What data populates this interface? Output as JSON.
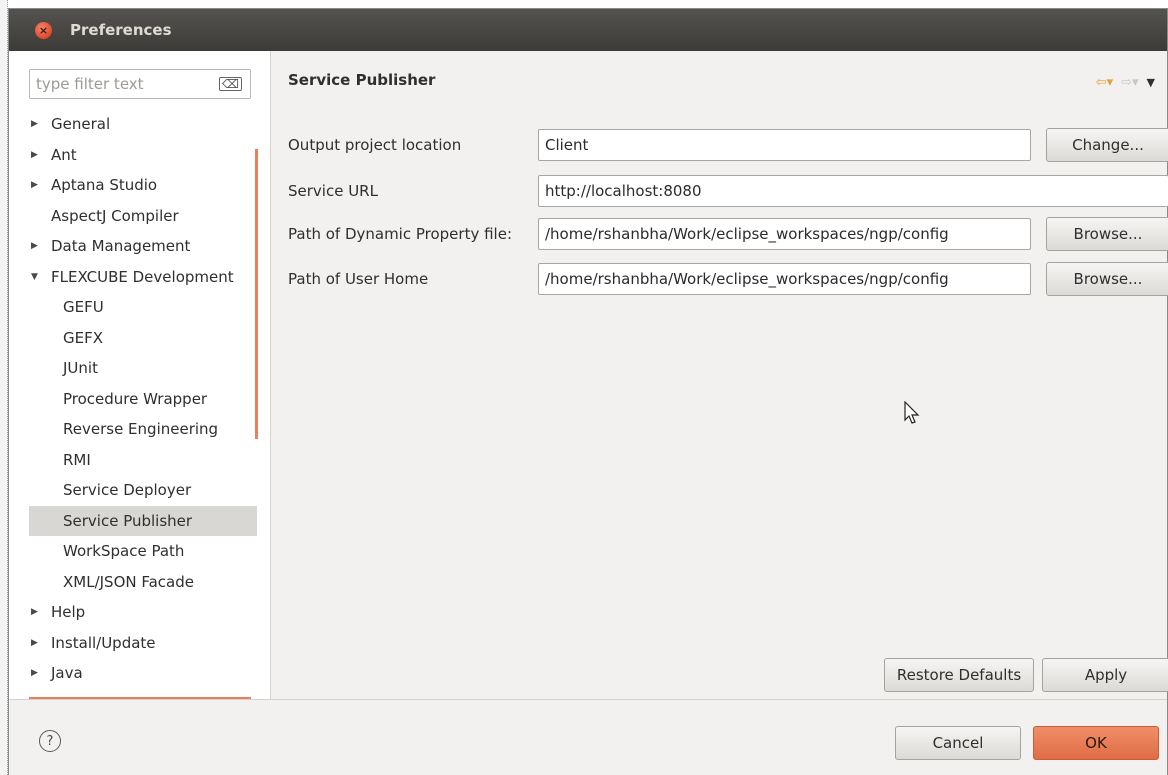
{
  "dialog": {
    "title": "Preferences"
  },
  "filter": {
    "placeholder": "type filter text"
  },
  "tree": {
    "items": [
      {
        "label": "General",
        "arrow": "▶"
      },
      {
        "label": "Ant",
        "arrow": "▶"
      },
      {
        "label": "Aptana Studio",
        "arrow": "▶"
      },
      {
        "label": "AspectJ Compiler",
        "arrow": ""
      },
      {
        "label": "Data Management",
        "arrow": "▶"
      },
      {
        "label": "FLEXCUBE Development",
        "arrow": "▼"
      },
      {
        "label": "GEFU",
        "arrow": ""
      },
      {
        "label": "GEFX",
        "arrow": ""
      },
      {
        "label": "JUnit",
        "arrow": ""
      },
      {
        "label": "Procedure Wrapper",
        "arrow": ""
      },
      {
        "label": "Reverse Engineering",
        "arrow": ""
      },
      {
        "label": "RMI",
        "arrow": ""
      },
      {
        "label": "Service Deployer",
        "arrow": ""
      },
      {
        "label": "Service Publisher",
        "arrow": ""
      },
      {
        "label": "WorkSpace Path",
        "arrow": ""
      },
      {
        "label": "XML/JSON Facade",
        "arrow": ""
      },
      {
        "label": "Help",
        "arrow": "▶"
      },
      {
        "label": "Install/Update",
        "arrow": "▶"
      },
      {
        "label": "Java",
        "arrow": "▶"
      }
    ],
    "selected": "Service Publisher"
  },
  "page": {
    "title": "Service Publisher",
    "nav": {
      "back": "⇦▾",
      "forward": "⇨▾",
      "menu": "▼"
    }
  },
  "form": {
    "output_location": {
      "label": "Output project location",
      "value": "Client",
      "button": "Change..."
    },
    "service_url": {
      "label": "Service URL",
      "value": "http://localhost:8080"
    },
    "dynamic_property": {
      "label": "Path of Dynamic Property file:",
      "value": "/home/rshanbha/Work/eclipse_workspaces/ngp/config",
      "button": "Browse..."
    },
    "user_home": {
      "label": "Path of User Home",
      "value": "/home/rshanbha/Work/eclipse_workspaces/ngp/config",
      "button": "Browse..."
    }
  },
  "actions": {
    "restore_defaults": "Restore Defaults",
    "apply": "Apply",
    "cancel": "Cancel",
    "ok": "OK",
    "help": "?"
  },
  "colors": {
    "accent": "#e8815a",
    "titlebar": "#3c3b37"
  }
}
